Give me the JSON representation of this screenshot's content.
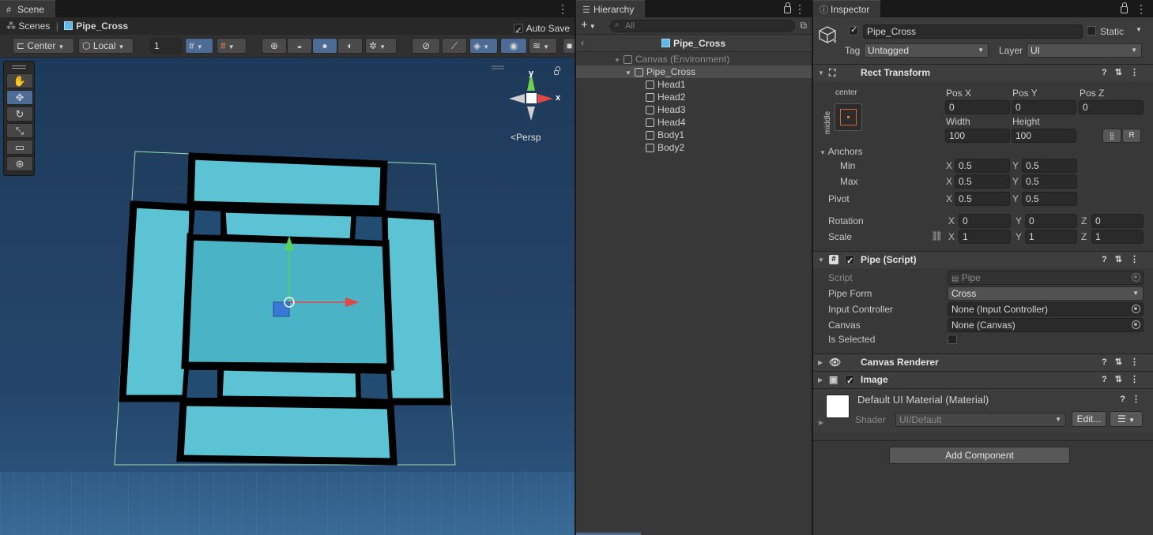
{
  "scene": {
    "tab": "Scene",
    "auto_save": "Auto Save",
    "breadcrumb_root": "Scenes",
    "breadcrumb_current": "Pipe_Cross",
    "pivot_mode": "Center",
    "space_mode": "Local",
    "grid_size": "1",
    "persp_label": "Persp",
    "gizmo_y": "y",
    "gizmo_x": "x"
  },
  "hierarchy": {
    "tab": "Hierarchy",
    "search_placeholder": "All",
    "prefab_title": "Pipe_Cross",
    "items": [
      {
        "label": "Canvas (Environment)"
      },
      {
        "label": "Pipe_Cross"
      },
      {
        "label": "Head1"
      },
      {
        "label": "Head2"
      },
      {
        "label": "Head3"
      },
      {
        "label": "Head4"
      },
      {
        "label": "Body1"
      },
      {
        "label": "Body2"
      }
    ]
  },
  "inspector": {
    "tab": "Inspector",
    "object_name": "Pipe_Cross",
    "static_label": "Static",
    "tag_label": "Tag",
    "tag_value": "Untagged",
    "layer_label": "Layer",
    "layer_value": "UI",
    "rect_transform": {
      "title": "Rect Transform",
      "anchor_h": "center",
      "anchor_v": "middle",
      "pos_x_label": "Pos X",
      "pos_y_label": "Pos Y",
      "pos_z_label": "Pos Z",
      "pos_x": "0",
      "pos_y": "0",
      "pos_z": "0",
      "width_label": "Width",
      "height_label": "Height",
      "width": "100",
      "height": "100",
      "r_button": "R",
      "anchors_label": "Anchors",
      "min_label": "Min",
      "max_label": "Max",
      "min_x": "0.5",
      "min_y": "0.5",
      "max_x": "0.5",
      "max_y": "0.5",
      "pivot_label": "Pivot",
      "pivot_x": "0.5",
      "pivot_y": "0.5",
      "rotation_label": "Rotation",
      "rot_x": "0",
      "rot_y": "0",
      "rot_z": "0",
      "scale_label": "Scale",
      "scale_x": "1",
      "scale_y": "1",
      "scale_z": "1",
      "x": "X",
      "y": "Y",
      "z": "Z"
    },
    "pipe_script": {
      "title": "Pipe (Script)",
      "script_label": "Script",
      "script_value": "Pipe",
      "pipe_form_label": "Pipe Form",
      "pipe_form_value": "Cross",
      "input_controller_label": "Input Controller",
      "input_controller_value": "None (Input Controller)",
      "canvas_label": "Canvas",
      "canvas_value": "None (Canvas)",
      "is_selected_label": "Is Selected"
    },
    "canvas_renderer": {
      "title": "Canvas Renderer"
    },
    "image": {
      "title": "Image"
    },
    "material": {
      "name": "Default UI Material (Material)",
      "shader_label": "Shader",
      "shader_value": "UI/Default",
      "edit_button": "Edit..."
    },
    "add_component": "Add Component"
  },
  "colors": {
    "accent_blue": "#4c6b95",
    "pipe_fill": "#5cc3d4",
    "viewport_bg": "#25466b"
  }
}
